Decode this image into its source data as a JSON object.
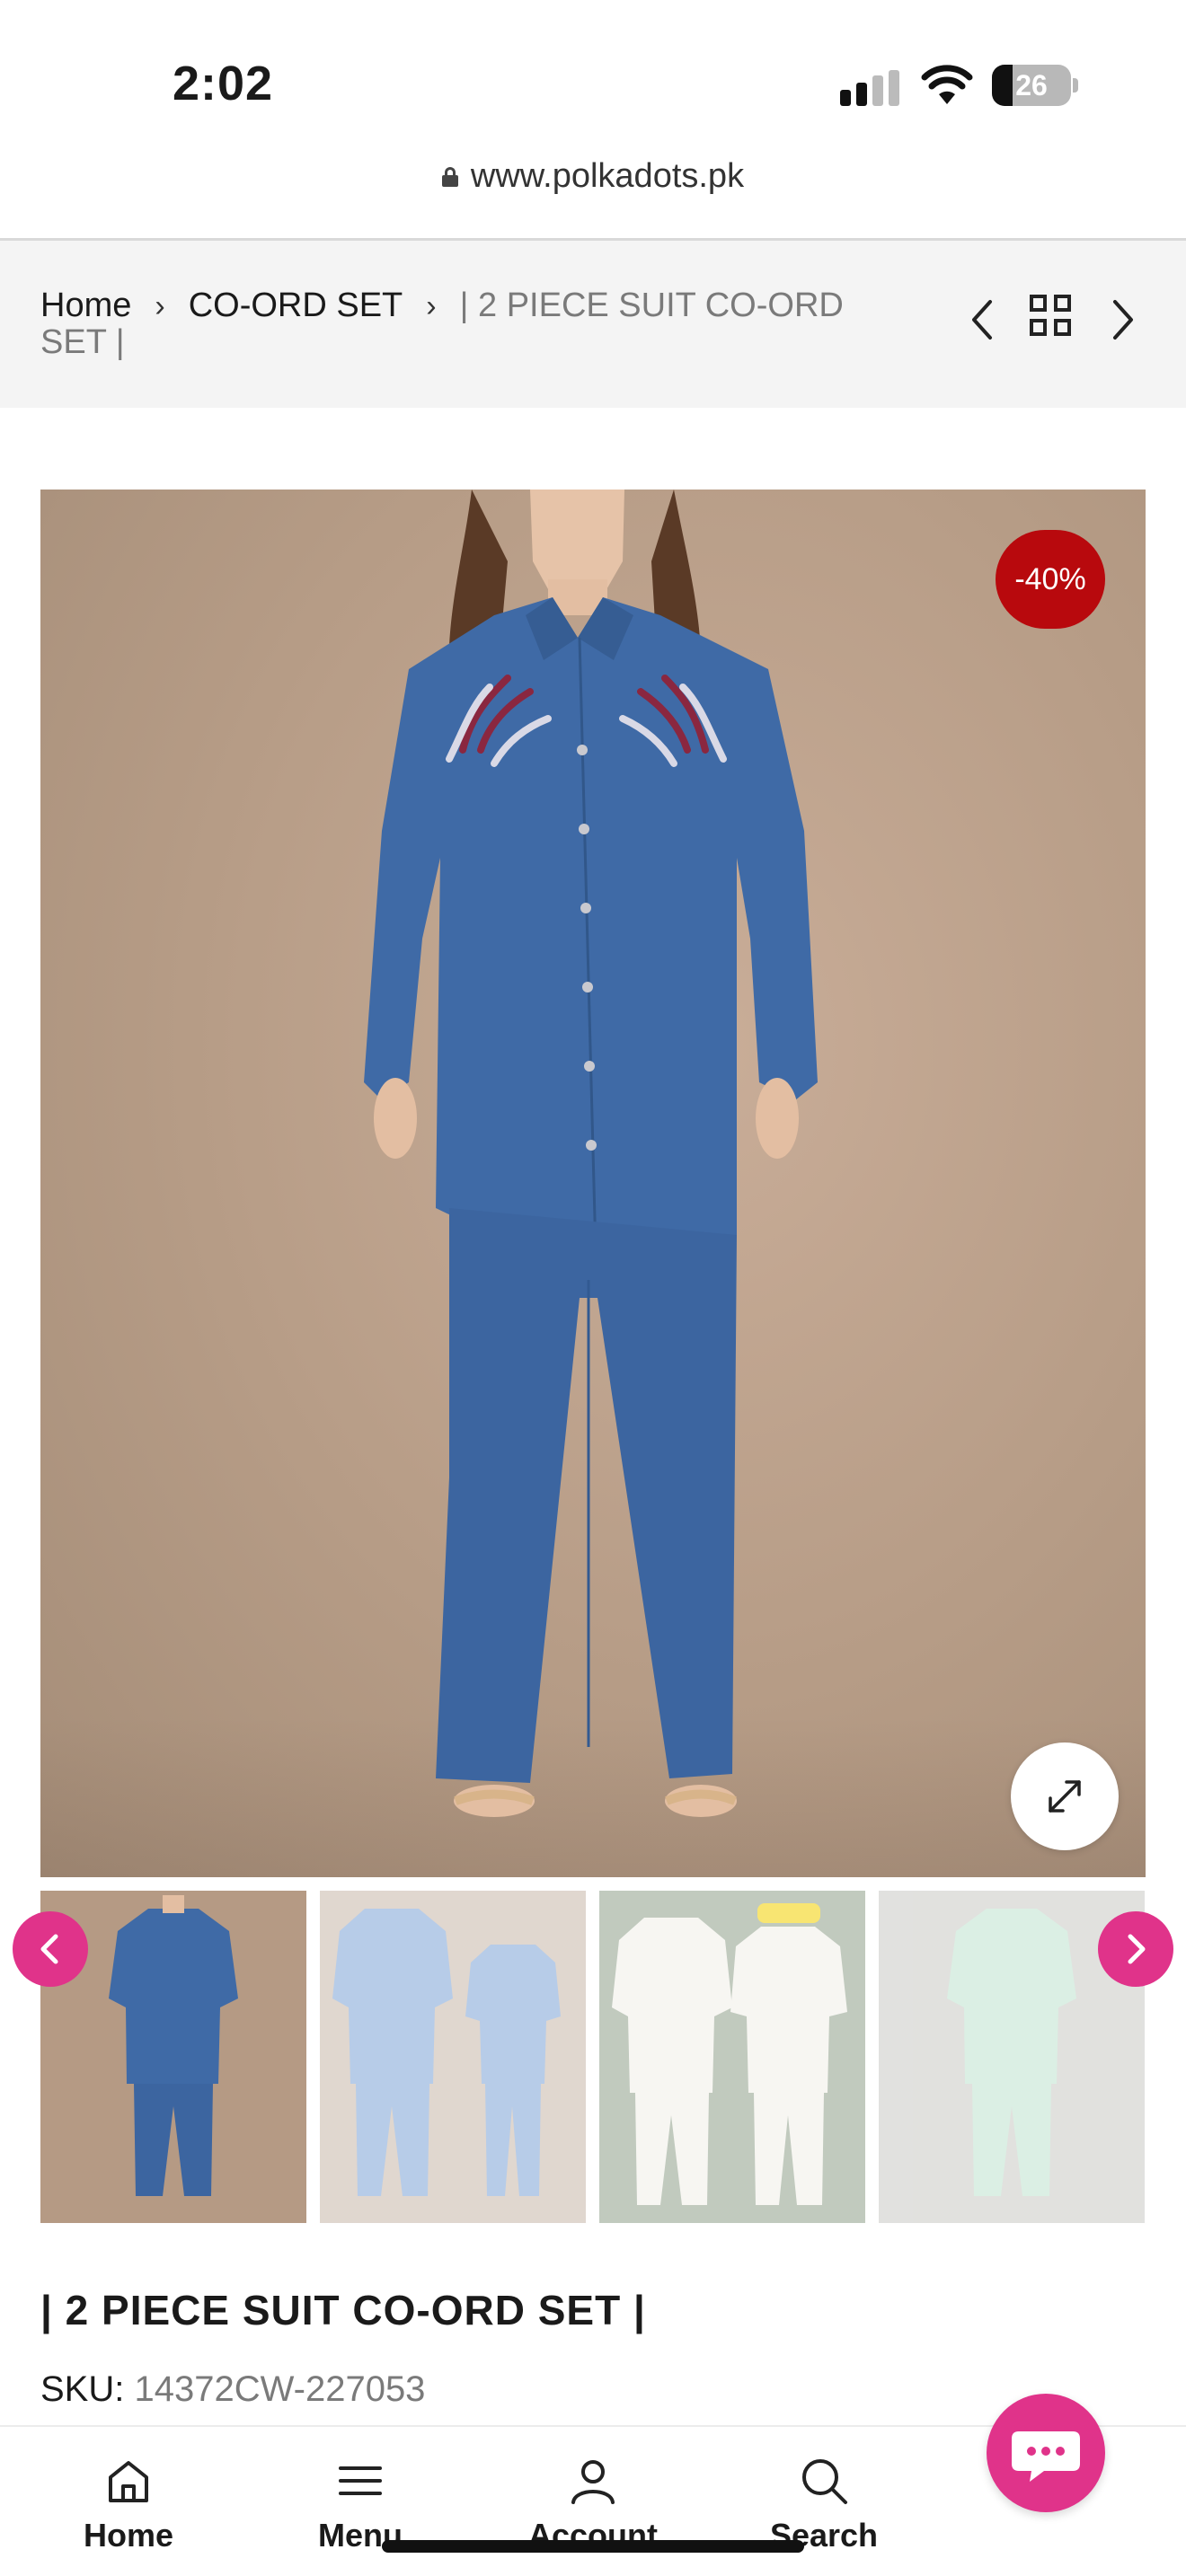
{
  "status_bar": {
    "time": "2:02",
    "battery": "26",
    "battery_level": 0.26
  },
  "url_bar": {
    "domain": "www.polkadots.pk"
  },
  "breadcrumb": {
    "items": [
      {
        "label": "Home"
      },
      {
        "label": "CO-ORD SET"
      }
    ],
    "current": "| 2 PIECE SUIT CO-ORD SET |"
  },
  "product": {
    "discount_badge": "-40%",
    "title": "| 2 PIECE SUIT CO-ORD SET |",
    "sku_label": "SKU:",
    "sku_value": "14372CW-227053",
    "colors": {
      "accent": "#e0338a",
      "badge": "#b8090d",
      "suit_blue": "#3f6aa6"
    },
    "thumbnails": [
      {
        "variant": "blue",
        "color": "#3f6aa6"
      },
      {
        "variant": "light-blue",
        "color": "#7ea3d6"
      },
      {
        "variant": "white",
        "color": "#f2efe9"
      },
      {
        "variant": "mint",
        "color": "#bfe3cf"
      }
    ]
  },
  "bottom_nav": {
    "items": [
      {
        "label": "Home",
        "icon": "home-icon"
      },
      {
        "label": "Menu",
        "icon": "menu-icon"
      },
      {
        "label": "Account",
        "icon": "account-icon"
      },
      {
        "label": "Search",
        "icon": "search-icon"
      }
    ],
    "chat_icon": "chat-bubble-icon"
  }
}
